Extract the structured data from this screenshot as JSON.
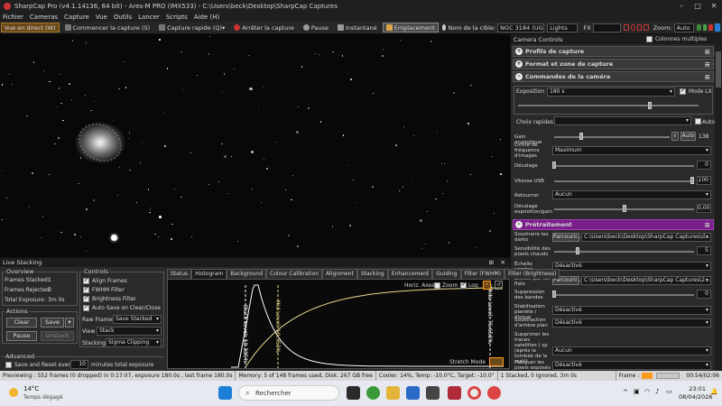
{
  "window": {
    "title": "SharpCap Pro (v4.1.14136, 64 bit) - Ares-M PRO (IMX533) - C:\\Users\\beck\\Desktop\\SharpCap Captures"
  },
  "menu": [
    "Fichier",
    "Cameras",
    "Capture",
    "Vue",
    "Outils",
    "Lancer",
    "Scripts",
    "Aide (H)"
  ],
  "toolbar": {
    "live_view": "Vue en direct (W)",
    "start_capture": "Commencer la capture (S)",
    "quick_capture": "Capture rapide (Q)",
    "stop_capture": "Arrêter la capture",
    "pause": "Pause",
    "snapshot": "Instantané",
    "location": "Emplacement",
    "target_label": "Nom de la cible:",
    "target_value": "NGC 3184 (UG",
    "frame_type": "Lights",
    "fx_label": "FX",
    "zoom_label": "Zoom:",
    "zoom_value": "Auto"
  },
  "camera_controls": {
    "title": "Camera Controls",
    "multi_columns": "Colonnes multiples",
    "sections": {
      "capture_profiles": "Profils de capture",
      "format": "Format et zone de capture",
      "camera": "Commandes de la caméra",
      "preprocessing": "Prétraitement"
    },
    "exposure_label": "Exposition",
    "exposure_value": "180 s",
    "lx_mode": "Mode LX",
    "quick_choices": "Choix rapides",
    "auto": "Auto",
    "gain_label": "Gain analogique",
    "gain_auto": "Auto",
    "gain_value": "138",
    "frame_rate_label": "Limite de fréquence d'images",
    "frame_rate_value": "Maximum",
    "offset_label": "Décalage",
    "offset_value": "0",
    "usb_label": "Vitesse USB",
    "usb_value": "100",
    "flip_label": "Retourner",
    "flip_value": "Aucun",
    "exp_offset_label": "Décalage exposition/gain",
    "exp_offset_value": "0,00",
    "subtract_darks_label": "Soustraire les darks",
    "browse": "Parcourir...",
    "darks_path": "C:\\Users\\beck\\Desktop\\SharpCap Captures\\d...",
    "hot_pixel_label": "Sensibilité des pixels chauds",
    "hot_pixel_value": "5",
    "dark_scale_label": "Échelle sombre (expérimentale)",
    "dark_scale_value": "Désactivé",
    "divide_flats_label": "Diviser par les flats",
    "flats_path": "C:\\Users\\beck\\Desktop\\SharpCap Captures\\2...",
    "banding_label": "Suppression des bandes",
    "banding_value": "0",
    "stabilization_label": "Stabilisation planète / disque",
    "stabilization_value": "Désactivé",
    "sky_sub_label": "Soustraction d'arrière plan",
    "sky_sub_value": "Désactivé",
    "sat_trails_label": "Supprimer les traces satellites ( sp (après la tombée de la nuit))",
    "sat_trails_value": "Aucun",
    "mask_label": "Masquer les pixels exposés",
    "mask_value": "Désactivé"
  },
  "live_stacking": {
    "title": "Live Stacking",
    "overview_title": "Overview",
    "frames_stacked_label": "Frames Stacked:",
    "frames_stacked_value": "1",
    "frames_rejected_label": "Frames Rejected:",
    "frames_rejected_value": "0",
    "total_exposure_label": "Total Exposure:",
    "total_exposure_value": "3m 0s",
    "actions_title": "Actions",
    "clear": "Clear",
    "save": "Save",
    "pause": "Pause",
    "unstack": "Unstack",
    "controls_title": "Controls",
    "align_frames": "Align Frames",
    "fwhm_filter": "FWHM Filter",
    "brightness_filter": "Brightness Filter",
    "auto_save": "Auto Save on Clear/Close",
    "raw_frames_label": "Raw Frames",
    "raw_frames_value": "Save Stacked",
    "view_label": "View",
    "view_value": "Stack",
    "stacking_label": "Stacking",
    "stacking_value": "Sigma Clipping",
    "advanced_title": "Advanced",
    "save_reset": "Save and Reset every",
    "save_reset_value": "10",
    "minutes_label": "minutes total exposure",
    "tabs": [
      "Status",
      "Histogram",
      "Background",
      "Colour Calibration",
      "Alignment",
      "Stacking",
      "Enhancement",
      "Guiding",
      "Filter (FWHM)",
      "Filter (Brightness)"
    ],
    "active_tab": "Histogram",
    "histogram": {
      "horiz_axes": "Horiz. Axes:",
      "zoom": "Zoom",
      "log": "Log",
      "black_level": "Black Level: 10.385%",
      "mid_level": "Mid Level: 10.753%",
      "white_level": "White Level: 76.658%",
      "stretch_mode": "Stretch Mode"
    }
  },
  "statusbar": {
    "preview": "Previewing : 552 frames (0 dropped) in 0:17:07, exposure 180.0s , last frame 180.0s",
    "memory": "Memory: 5 of 148 frames used, Disk: 267 GB free",
    "cooler": "Cooler: 14%, Temp: -10.0°C, Target: -10.0°",
    "stacked": "1 Stacked, 0 Ignored, 3m 0s",
    "frame_label": "Frame :",
    "frame_time": "00:54/02:06"
  },
  "taskbar": {
    "weather_temp": "14°C",
    "weather_desc": "Temps dégagé",
    "search": "Rechercher",
    "time": "23:01",
    "date": "08/04/2026"
  },
  "colors": {
    "accent_orange": "#ff9a1f",
    "purple_section": "#7a1f8a",
    "histogram_curve": "#ffffff",
    "stretch_curve": "#e8d98a"
  }
}
